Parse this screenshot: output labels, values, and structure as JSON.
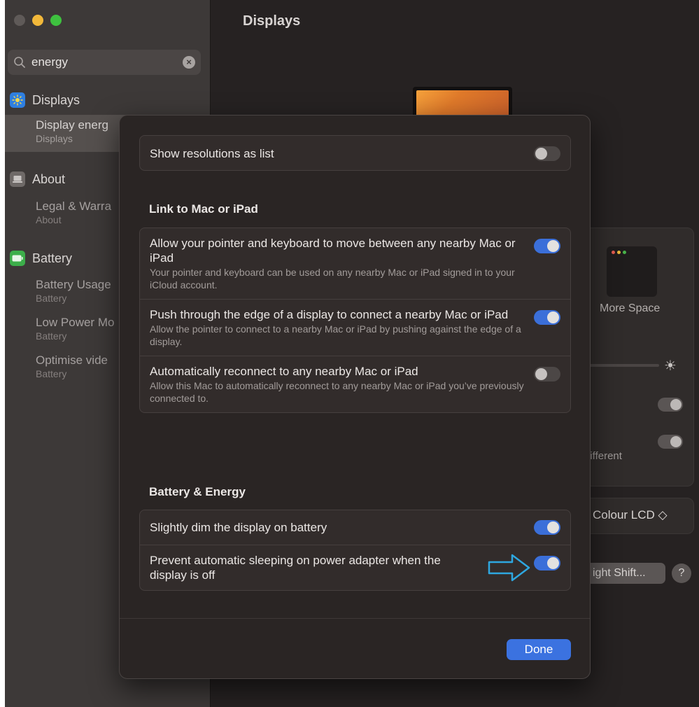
{
  "window": {
    "title": "Displays"
  },
  "search": {
    "value": "energy",
    "icon": "magnifier"
  },
  "sidebar": {
    "sections": [
      {
        "label": "Displays",
        "icon": "sun-icon",
        "color": "#2f7fe0",
        "items": [
          {
            "label": "Display energ",
            "sub": "Displays",
            "selected": true
          }
        ]
      },
      {
        "label": "About",
        "icon": "laptop-icon",
        "color": "#6f6a68",
        "items": [
          {
            "label": "Legal & Warra",
            "sub": "About"
          }
        ]
      },
      {
        "label": "Battery",
        "icon": "battery-icon",
        "color": "#3cae4a",
        "items": [
          {
            "label": "Battery Usage",
            "sub": "Battery"
          },
          {
            "label": "Low Power Mo",
            "sub": "Battery"
          },
          {
            "label": "Optimise vide",
            "sub": "Battery"
          }
        ]
      }
    ]
  },
  "background": {
    "more_space": "More Space",
    "different": "different",
    "lcd": "Colour LCD ◇",
    "night_shift": "ight Shift...",
    "help": "?"
  },
  "sheet": {
    "top_group": [
      {
        "title": "Show resolutions as list",
        "on": false
      }
    ],
    "link_header": "Link to Mac or iPad",
    "link_group": [
      {
        "title": "Allow your pointer and keyboard to move between any nearby Mac or iPad",
        "desc": "Your pointer and keyboard can be used on any nearby Mac or iPad signed in to your iCloud account.",
        "on": true
      },
      {
        "title": "Push through the edge of a display to connect a nearby Mac or iPad",
        "desc": "Allow the pointer to connect to a nearby Mac or iPad by pushing against the edge of a display.",
        "on": true
      },
      {
        "title": "Automatically reconnect to any nearby Mac or iPad",
        "desc": "Allow this Mac to automatically reconnect to any nearby Mac or iPad you’ve previously connected to.",
        "on": false
      }
    ],
    "battery_header": "Battery & Energy",
    "battery_group": [
      {
        "title": "Slightly dim the display on battery",
        "on": true
      },
      {
        "title": "Prevent automatic sleeping on power adapter when the display is off",
        "on": true
      }
    ],
    "done_label": "Done"
  },
  "colors": {
    "accent": "#3b6fd9",
    "arrow": "#2ea7e0"
  }
}
